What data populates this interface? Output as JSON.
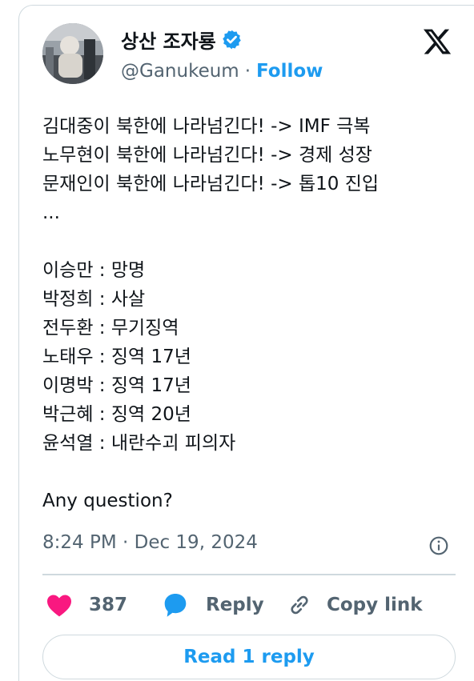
{
  "author": {
    "display_name": "상산 조자룡",
    "handle": "@Ganukeum",
    "separator": "·",
    "follow_label": "Follow"
  },
  "tweet": {
    "lines": [
      "김대중이 북한에 나라넘긴다! -> IMF 극복",
      "노무현이 북한에 나라넘긴다! -> 경제 성장",
      "문재인이 북한에 나라넘긴다! -> 톱10 진입",
      "...",
      "",
      "이승만 : 망명",
      "박정희 : 사살",
      "전두환 : 무기징역",
      "노태우 : 징역 17년",
      "이명박 : 징역 17년",
      "박근혜 : 징역 20년",
      "윤석열 : 내란수괴 피의자",
      "",
      "Any question?"
    ],
    "timestamp": "8:24 PM · Dec 19, 2024"
  },
  "actions": {
    "like_count": "387",
    "reply_label": "Reply",
    "copy_link_label": "Copy link"
  },
  "read_replies_label": "Read 1 reply",
  "colors": {
    "accent": "#1d9bf0",
    "like": "#f91880",
    "text": "#0f1419",
    "muted": "#536471",
    "border": "#cfd9de"
  },
  "icons": {
    "logo": "x-logo-icon",
    "verified": "verified-badge-icon",
    "info": "info-icon",
    "like": "heart-icon",
    "reply": "speech-bubble-icon",
    "copy": "link-icon"
  }
}
